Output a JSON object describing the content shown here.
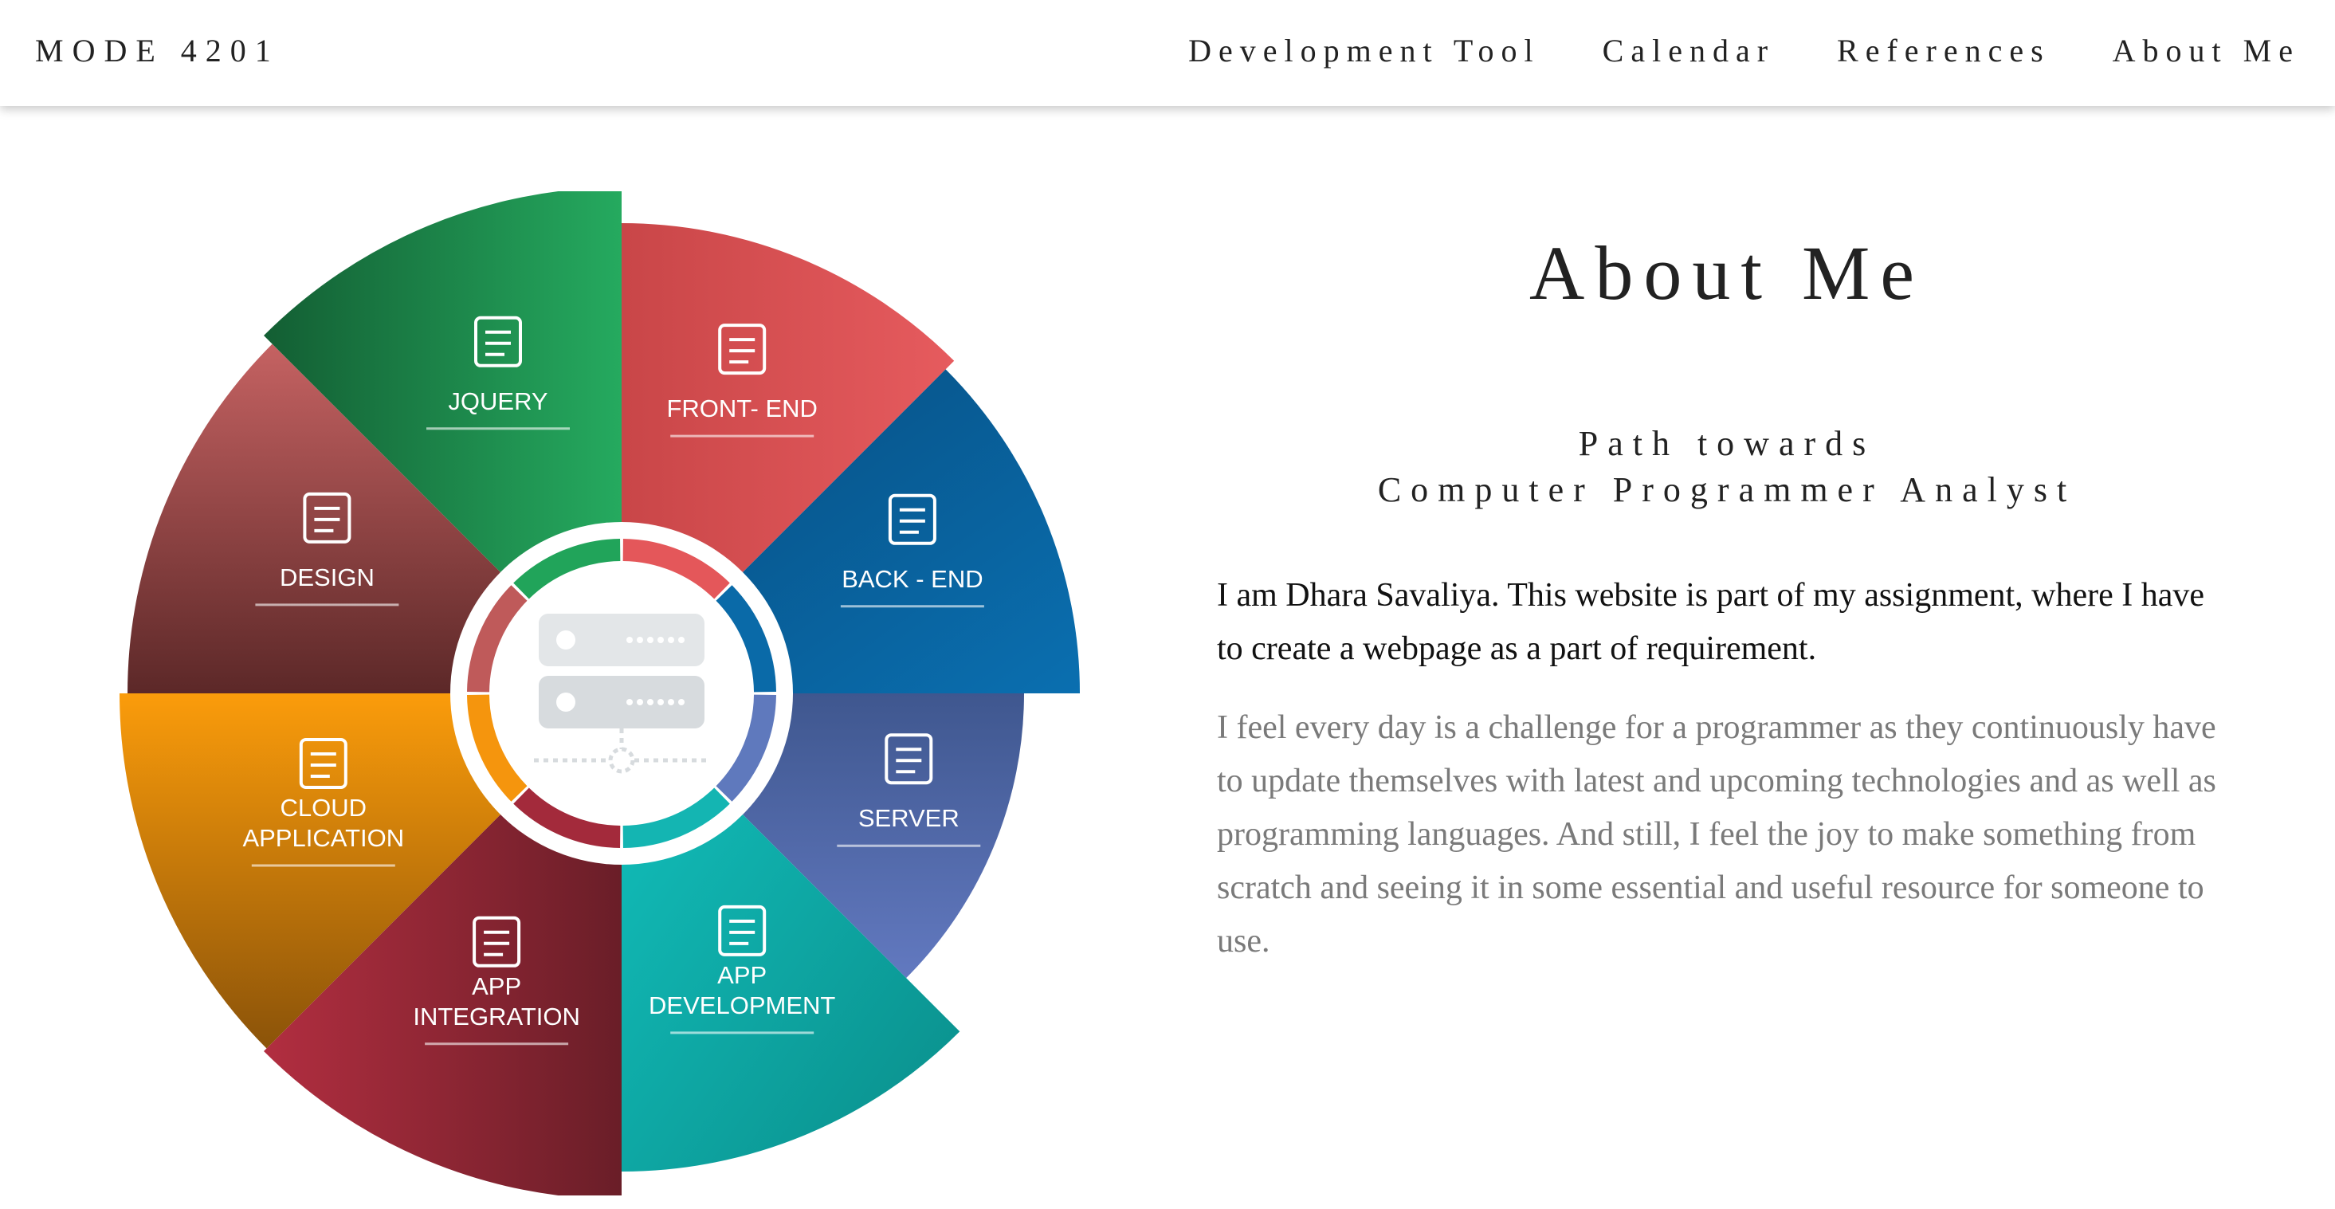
{
  "brand": "MODE 4201",
  "nav": {
    "items": [
      "Development Tool",
      "Calendar",
      "References",
      "About Me"
    ]
  },
  "wheel": {
    "segments": [
      {
        "label_lines": [
          "FRONT- END"
        ],
        "icon": "browser-code-icon",
        "color": "#e4575a"
      },
      {
        "label_lines": [
          "BACK - END"
        ],
        "icon": "mobile-gears-icon",
        "color": "#0a6aa8"
      },
      {
        "label_lines": [
          "SERVER"
        ],
        "icon": "server-rack-icon",
        "color": "#5f79bd"
      },
      {
        "label_lines": [
          "APP",
          "DEVELOPMENT"
        ],
        "icon": "mobile-plus-icon",
        "color": "#14b5b2"
      },
      {
        "label_lines": [
          "APP",
          "INTEGRATION"
        ],
        "icon": "puzzle-icon",
        "color": "#a32a3b"
      },
      {
        "label_lines": [
          "CLOUD",
          "APPLICATION"
        ],
        "icon": "cloud-network-icon",
        "color": "#f5950d"
      },
      {
        "label_lines": [
          "DESIGN"
        ],
        "icon": "blueprint-icon",
        "color": "#bf5a5a"
      },
      {
        "label_lines": [
          "JQUERY"
        ],
        "icon": "jquery-logo-icon",
        "color": "#21a45a"
      }
    ],
    "center_icon": "server-stack-icon"
  },
  "about": {
    "title": "About Me",
    "subtitle_line1": "Path towards",
    "subtitle_line2": "Computer Programmer Analyst",
    "intro": "I am Dhara Savaliya. This website is part of my assignment, where I have to create a webpage as a part of requirement.",
    "body": "I feel every day is a challenge for a programmer as they continuously have to update themselves with latest and upcoming technologies and as well as programming languages. And still, I feel the joy to make something from scratch and seeing it in some essential and useful resource for someone to use."
  }
}
